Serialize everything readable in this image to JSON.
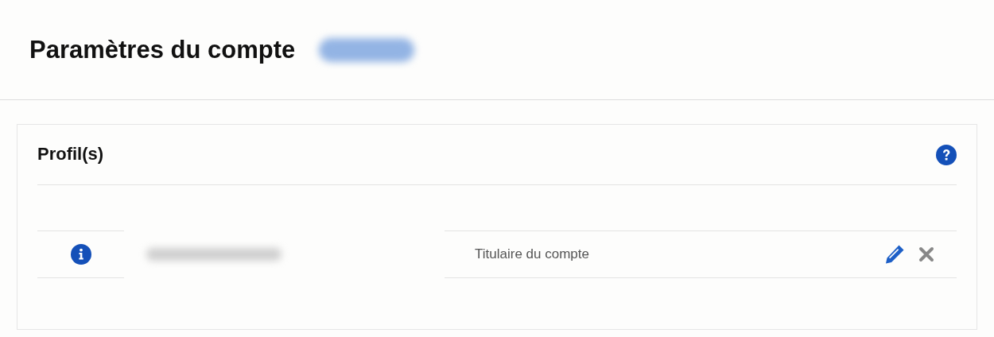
{
  "page": {
    "title": "Paramètres du compte"
  },
  "profiles": {
    "title": "Profil(s)",
    "rows": [
      {
        "role": "Titulaire du compte"
      }
    ]
  }
}
